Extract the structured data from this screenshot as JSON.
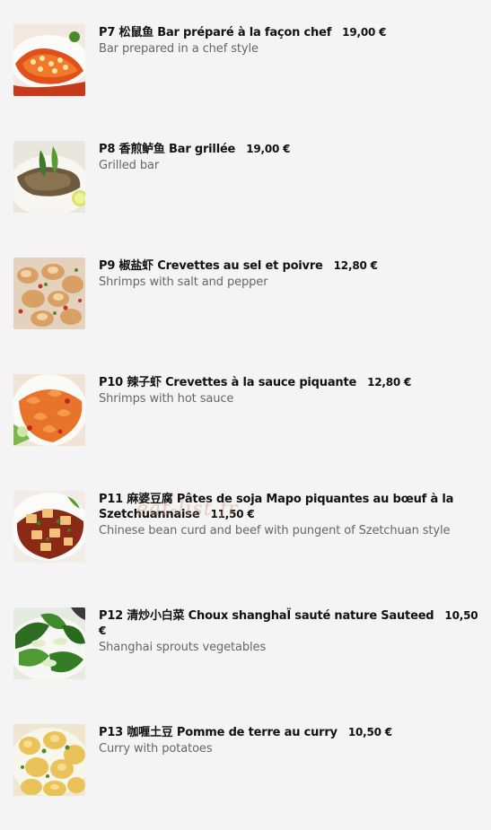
{
  "menu": {
    "items": [
      {
        "code": "P7",
        "name": "松鼠鱼 Bar préparé à la façon chef",
        "price": "19,00 €",
        "desc": "Bar prepared in a chef style",
        "icon": "squirrel-fish-dish-photo"
      },
      {
        "code": "P8",
        "name": "香煎鲈鱼 Bar grillée",
        "price": "19,00 €",
        "desc": "Grilled bar",
        "icon": "grilled-bass-dish-photo"
      },
      {
        "code": "P9",
        "name": "椒盐虾 Crevettes au sel et poivre",
        "price": "12,80 €",
        "desc": "Shrimps with salt and pepper",
        "icon": "salt-pepper-shrimp-dish-photo"
      },
      {
        "code": "P10",
        "name": "辣子虾 Crevettes à la sauce piquante",
        "price": "12,80 €",
        "desc": "Shrimps with hot sauce",
        "icon": "hot-sauce-shrimp-dish-photo"
      },
      {
        "code": "P11",
        "name": "麻婆豆腐 Pâtes de soja Mapo piquantes au bœuf à la Szetchuannaise",
        "price": "11,50 €",
        "desc": "Chinese bean curd and beef with pungent of Szetchuan style",
        "icon": "mapo-tofu-dish-photo"
      },
      {
        "code": "P12",
        "name": "清炒小白菜 Choux shanghaÏ sauté nature Sauteed",
        "price": "10,50 €",
        "desc": "Shanghai sprouts vegetables",
        "icon": "shanghai-greens-dish-photo"
      },
      {
        "code": "P13",
        "name": "咖喱土豆 Pomme de terre au curry",
        "price": "10,50 €",
        "desc": "Curry with potatoes",
        "icon": "curry-potatoes-dish-photo"
      }
    ]
  },
  "watermark": "eat-list.fr"
}
